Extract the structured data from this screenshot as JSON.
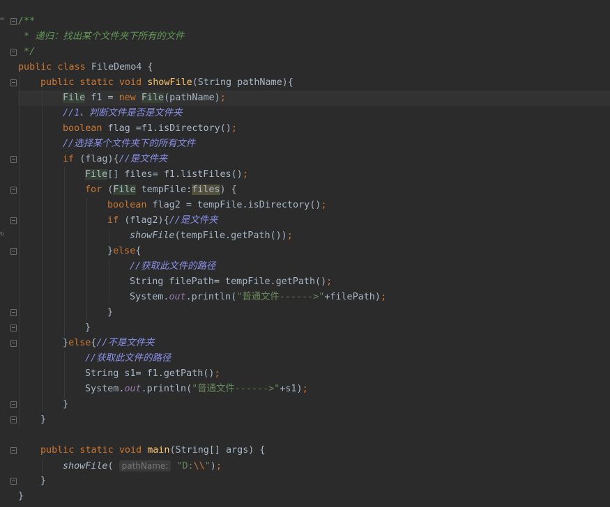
{
  "editor": {
    "language": "java",
    "current_line": 6,
    "lines": [
      {
        "indent": 0,
        "tokens": [
          [
            "cm",
            "/**"
          ]
        ]
      },
      {
        "indent": 0,
        "tokens": [
          [
            "cm",
            " * 递归：找出某个文件夹下所有的文件"
          ]
        ]
      },
      {
        "indent": 0,
        "tokens": [
          [
            "cm",
            " */"
          ]
        ]
      },
      {
        "indent": 0,
        "tokens": [
          [
            "kw",
            "public class "
          ],
          [
            "pl",
            "FileDemo4 {"
          ]
        ]
      },
      {
        "indent": 1,
        "tokens": [
          [
            "kw",
            "public static void "
          ],
          [
            "fn",
            "showFile"
          ],
          [
            "pl",
            "(String pathName){"
          ]
        ]
      },
      {
        "indent": 2,
        "tokens": [
          [
            "hl",
            "File"
          ],
          [
            "pl",
            " f1 = "
          ],
          [
            "kw",
            "new "
          ],
          [
            "hl",
            "File"
          ],
          [
            "pl",
            "(pathName)"
          ],
          [
            "kw",
            ";"
          ]
        ]
      },
      {
        "indent": 2,
        "tokens": [
          [
            "lc",
            "//1、判断文件是否是文件夹"
          ]
        ]
      },
      {
        "indent": 2,
        "tokens": [
          [
            "kw",
            "boolean "
          ],
          [
            "pl",
            "flag =f1.isDirectory()"
          ],
          [
            "kw",
            ";"
          ]
        ]
      },
      {
        "indent": 2,
        "tokens": [
          [
            "lc",
            "//选择某个文件夹下的所有文件"
          ]
        ]
      },
      {
        "indent": 2,
        "tokens": [
          [
            "kw",
            "if "
          ],
          [
            "pl",
            "(flag){"
          ],
          [
            "lc",
            "//是文件夹"
          ]
        ]
      },
      {
        "indent": 3,
        "tokens": [
          [
            "hl",
            "File"
          ],
          [
            "pl",
            "[] files= f1.listFiles()"
          ],
          [
            "kw",
            ";"
          ]
        ]
      },
      {
        "indent": 3,
        "tokens": [
          [
            "kw",
            "for "
          ],
          [
            "pl",
            "("
          ],
          [
            "hl",
            "File"
          ],
          [
            "pl",
            " tempFile:"
          ],
          [
            "hl2",
            "files"
          ],
          [
            "pl",
            ") {"
          ]
        ]
      },
      {
        "indent": 4,
        "tokens": [
          [
            "kw",
            "boolean "
          ],
          [
            "pl",
            "flag2 = tempFile.isDirectory()"
          ],
          [
            "kw",
            ";"
          ]
        ]
      },
      {
        "indent": 4,
        "tokens": [
          [
            "kw",
            "if "
          ],
          [
            "pl",
            "(flag2){"
          ],
          [
            "lc",
            "//是文件夹"
          ]
        ]
      },
      {
        "indent": 5,
        "tokens": [
          [
            "st",
            "showFile"
          ],
          [
            "pl",
            "(tempFile.getPath())"
          ],
          [
            "kw",
            ";"
          ]
        ]
      },
      {
        "indent": 4,
        "tokens": [
          [
            "pl",
            "}"
          ],
          [
            "kw",
            "else"
          ],
          [
            "pl",
            "{"
          ]
        ]
      },
      {
        "indent": 5,
        "tokens": [
          [
            "lc",
            "//获取此文件的路径"
          ]
        ]
      },
      {
        "indent": 5,
        "tokens": [
          [
            "pl",
            "String filePath= tempFile.getPath()"
          ],
          [
            "kw",
            ";"
          ]
        ]
      },
      {
        "indent": 5,
        "tokens": [
          [
            "pl",
            "System."
          ],
          [
            "sf",
            "out"
          ],
          [
            "pl",
            ".println("
          ],
          [
            "str",
            "\"普通文件------>\""
          ],
          [
            "pl",
            "+filePath)"
          ],
          [
            "kw",
            ";"
          ]
        ]
      },
      {
        "indent": 4,
        "tokens": [
          [
            "pl",
            "}"
          ]
        ]
      },
      {
        "indent": 3,
        "tokens": [
          [
            "pl",
            "}"
          ]
        ]
      },
      {
        "indent": 2,
        "tokens": [
          [
            "pl",
            "}"
          ],
          [
            "kw",
            "else"
          ],
          [
            "pl",
            "{"
          ],
          [
            "lc",
            "//不是文件夹"
          ]
        ]
      },
      {
        "indent": 3,
        "tokens": [
          [
            "lc",
            "//获取此文件的路径"
          ]
        ]
      },
      {
        "indent": 3,
        "tokens": [
          [
            "pl",
            "String s1= f1.getPath()"
          ],
          [
            "kw",
            ";"
          ]
        ]
      },
      {
        "indent": 3,
        "tokens": [
          [
            "pl",
            "System."
          ],
          [
            "sf",
            "out"
          ],
          [
            "pl",
            ".println("
          ],
          [
            "str",
            "\"普通文件------>\""
          ],
          [
            "pl",
            "+s1)"
          ],
          [
            "kw",
            ";"
          ]
        ]
      },
      {
        "indent": 2,
        "tokens": [
          [
            "pl",
            "}"
          ]
        ]
      },
      {
        "indent": 1,
        "tokens": [
          [
            "pl",
            "}"
          ]
        ]
      },
      {
        "indent": 0,
        "tokens": []
      },
      {
        "indent": 1,
        "tokens": [
          [
            "kw",
            "public static void "
          ],
          [
            "fn",
            "main"
          ],
          [
            "pl",
            "(String[] args) {"
          ]
        ]
      },
      {
        "indent": 2,
        "tokens": [
          [
            "st",
            "showFile"
          ],
          [
            "pl",
            "( "
          ],
          [
            "hint",
            "pathName:"
          ],
          [
            "pl",
            " "
          ],
          [
            "str",
            "\"D:"
          ],
          [
            "esc",
            "\\\\"
          ],
          [
            "str",
            "\""
          ],
          [
            "pl",
            ")"
          ],
          [
            "kw",
            ";"
          ]
        ]
      },
      {
        "indent": 1,
        "tokens": [
          [
            "pl",
            "}"
          ]
        ]
      },
      {
        "indent": 0,
        "tokens": [
          [
            "pl",
            "}"
          ]
        ]
      }
    ]
  },
  "gutter": {
    "fold_lines": [
      1,
      3,
      5,
      10,
      12,
      14,
      16,
      20,
      21,
      22,
      26,
      27,
      29,
      31
    ],
    "left_marks": [
      {
        "line": 1,
        "glyph": "="
      },
      {
        "line": 15,
        "glyph": "↻"
      }
    ]
  },
  "colors": {
    "background": "#2b2b2b",
    "keyword": "#cc7832",
    "function": "#ffc66d",
    "string": "#6a8759",
    "doc_comment": "#629755",
    "line_comment": "#8a8fe8",
    "static_field": "#9876aa",
    "text": "#a9b7c6"
  }
}
